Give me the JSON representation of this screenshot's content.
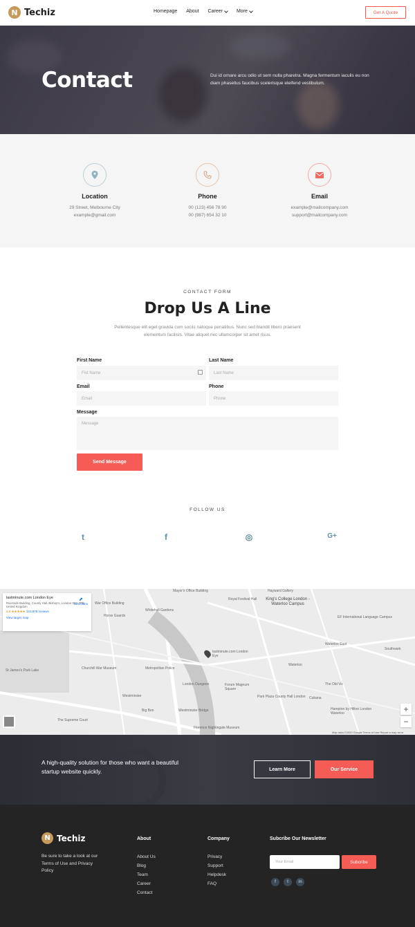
{
  "brand": {
    "name": "Techiz",
    "mark": "N"
  },
  "nav": {
    "items": [
      {
        "label": "Homepage",
        "dropdown": false
      },
      {
        "label": "About",
        "dropdown": false
      },
      {
        "label": "Career",
        "dropdown": true
      },
      {
        "label": "More",
        "dropdown": true
      }
    ],
    "cta": "Get A Quote"
  },
  "hero": {
    "title": "Contact",
    "text": "Dui id ornare arcu odio ut sem nulla pharetra. Magna fermentum iaculis eu non diam phasellus faucibus scelerisque eleifend vestibulum."
  },
  "contact_info": [
    {
      "icon": "location-pin-icon",
      "title": "Location",
      "lines": [
        "29 Street, Melbourne City",
        "example@gmail.com"
      ],
      "color": "#8fb3c4"
    },
    {
      "icon": "phone-icon",
      "title": "Phone",
      "lines": [
        "00 (123) 456 78 90",
        "00 (987) 654 32 10"
      ],
      "color": "#d6a07a"
    },
    {
      "icon": "envelope-icon",
      "title": "Email",
      "lines": [
        "example@mailcompany.com",
        "support@mailcompany.com"
      ],
      "color": "#f06a63"
    }
  ],
  "form": {
    "eyebrow": "CONTACT FORM",
    "title": "Drop Us A Line",
    "description": "Pellentesque elit eget gravida cum sociis natoque penatibus. Nunc sed blandit libero praesent elementum facilisis. Vitae aliquet nec ullamcorper sit amet risus.",
    "first_name": {
      "label": "First Name",
      "placeholder": "Fist Name"
    },
    "last_name": {
      "label": "Last Name",
      "placeholder": "Last Name"
    },
    "email": {
      "label": "Email",
      "placeholder": "Email"
    },
    "phone": {
      "label": "Phone",
      "placeholder": "Phone"
    },
    "message": {
      "label": "Message",
      "placeholder": "Message"
    },
    "submit": "Send Message"
  },
  "follow": {
    "title": "FOLLOW US",
    "icons": [
      "twitter-icon",
      "facebook-icon",
      "instagram-icon",
      "google-plus-icon"
    ],
    "glyphs": [
      "t",
      "f",
      "◎",
      "G+"
    ]
  },
  "map": {
    "place_name": "lastminute.com London Eye",
    "address": "Riverside Building, County Hall, Bishop's, London SE1 7PB, United Kingdom",
    "rating": "4.5 ★★★★★",
    "reviews": "123,878 reviews",
    "larger_map": "View larger map",
    "directions": "Directions",
    "labels": {
      "kings_college": "King's College London - Waterloo Campus",
      "royal_festival": "Royal Festival Hall",
      "whitehall": "Whitehall Gardens",
      "lastminute": "lastminute.com London Eye",
      "waterloo": "Waterloo",
      "westminster": "Westminster",
      "big_ben": "Big Ben",
      "st_james": "St James's Park Lake",
      "forum": "Forum Magnum Square",
      "park_plaza": "Park Plaza County Hall London",
      "southwark": "Southwark",
      "old_vic": "The Old Vic",
      "cubana": "Cubana",
      "hayward": "Hayward Gallery",
      "metropolitan": "Metropolitan Police",
      "ef_campus": "EF International Language Campus",
      "churchill": "Churchill War Museum",
      "westminster_bridge": "Westminster Bridge",
      "waterloo_east": "Waterloo East",
      "dungeon": "London Dungeon",
      "supreme_court": "The Supreme Court",
      "gov_office": "War Office Building",
      "horse_guards": "Horse Guards",
      "florence": "Florence Nightingale Museum",
      "hampton": "Hampton by Hilton London Waterloo",
      "gov_office2": "Mayor's Office Building"
    },
    "zoom_in": "+",
    "zoom_out": "−",
    "footer": "Map data ©2020 Google   Terms of Use   Report a map error"
  },
  "cta": {
    "text": "A high-quality solution for those who want a beautiful startup website quickly.",
    "learn_more": "Learn More",
    "service": "Our Service"
  },
  "footer": {
    "about": "Be sure to take a look at our Terms of Use and Privacy Policy",
    "col_about": {
      "title": "About",
      "links": [
        "About Us",
        "Blog",
        "Team",
        "Career",
        "Contact"
      ]
    },
    "col_company": {
      "title": "Company",
      "links": [
        "Privacy",
        "Support",
        "Helpdesk",
        "FAQ"
      ]
    },
    "newsletter": {
      "title": "Subcribe Our Newsletter",
      "placeholder": "Your Email",
      "button": "Subcribe"
    },
    "social": [
      "facebook-icon",
      "twitter-icon",
      "linkedin-icon"
    ]
  },
  "colors": {
    "accent": "#f55c55",
    "gold": "#c69a5b",
    "dark": "#242424"
  }
}
